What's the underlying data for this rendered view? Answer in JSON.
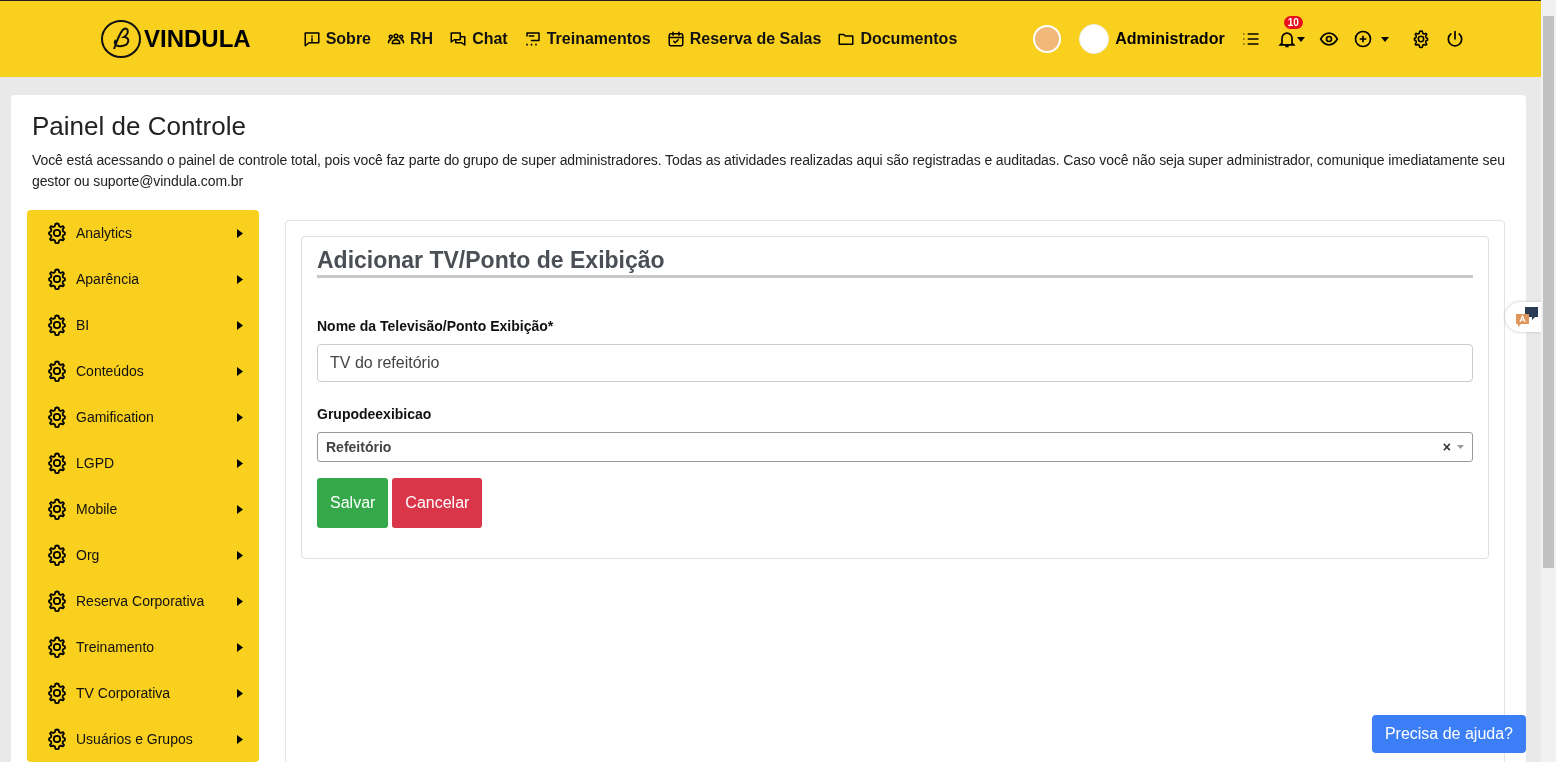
{
  "header": {
    "logo": "VINDULA",
    "nav": [
      {
        "label": "Sobre"
      },
      {
        "label": "RH"
      },
      {
        "label": "Chat"
      },
      {
        "label": "Treinamentos"
      },
      {
        "label": "Reserva de Salas"
      },
      {
        "label": "Documentos"
      }
    ],
    "user": "Administrador",
    "notification_count": "10"
  },
  "page": {
    "title": "Painel de Controle",
    "description": "Você está acessando o painel de controle total, pois você faz parte do grupo de super administradores. Todas as atividades realizadas aqui são registradas e auditadas. Caso você não seja super administrador, comunique imediatamente seu gestor ou suporte@vindula.com.br"
  },
  "sidebar": {
    "items": [
      {
        "label": "Analytics"
      },
      {
        "label": "Aparência"
      },
      {
        "label": "BI"
      },
      {
        "label": "Conteúdos"
      },
      {
        "label": "Gamification"
      },
      {
        "label": "LGPD"
      },
      {
        "label": "Mobile"
      },
      {
        "label": "Org"
      },
      {
        "label": "Reserva Corporativa"
      },
      {
        "label": "Treinamento"
      },
      {
        "label": "TV Corporativa"
      },
      {
        "label": "Usuários e Grupos"
      }
    ]
  },
  "form": {
    "title": "Adicionar TV/Ponto de Exibição",
    "fields": [
      {
        "kind": "text",
        "label": "Nome da Televisão/Ponto Exibição*",
        "value": "TV do refeitório"
      },
      {
        "kind": "select",
        "label": "Grupodeexibicao",
        "value": "Refeitório",
        "clear": "×"
      }
    ],
    "buttons": [
      {
        "label": "Salvar",
        "kind": "primary"
      },
      {
        "label": "Cancelar",
        "kind": "danger"
      }
    ]
  },
  "help_button": "Precisa de ajuda?"
}
